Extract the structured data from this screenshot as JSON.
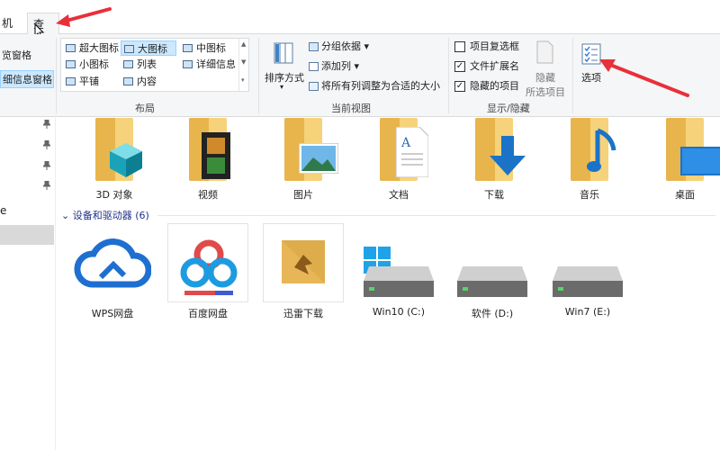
{
  "tabs": [
    {
      "label": "机"
    },
    {
      "label": "查看"
    }
  ],
  "panes": {
    "preview_pane": "览窗格",
    "details_pane": "细信息窗格"
  },
  "layout": {
    "group_label": "布局",
    "items": [
      {
        "label": "超大图标"
      },
      {
        "label": "大图标"
      },
      {
        "label": "中图标"
      },
      {
        "label": "小图标"
      },
      {
        "label": "列表"
      },
      {
        "label": "详细信息"
      },
      {
        "label": "平铺"
      },
      {
        "label": "内容"
      }
    ]
  },
  "current_view": {
    "group_label": "当前视图",
    "sort_by": "排序方式",
    "group_by": "分组依据",
    "add_column": "添加列",
    "fit_columns": "将所有列调整为合适的大小"
  },
  "show_hide": {
    "group_label": "显示/隐藏",
    "checkboxes": [
      {
        "label": "项目复选框",
        "checked": false
      },
      {
        "label": "文件扩展名",
        "checked": true
      },
      {
        "label": "隐藏的项目",
        "checked": true
      }
    ],
    "hide_selected_line1": "隐藏",
    "hide_selected_line2": "所选项目"
  },
  "options": {
    "label": "选项"
  },
  "navpane": {
    "cut_text": "e"
  },
  "folders": [
    {
      "label": "3D 对象",
      "icon": "3d-cube-icon"
    },
    {
      "label": "视频",
      "icon": "film-icon"
    },
    {
      "label": "图片",
      "icon": "picture-icon"
    },
    {
      "label": "文档",
      "icon": "document-icon"
    },
    {
      "label": "下载",
      "icon": "download-arrow-icon"
    },
    {
      "label": "音乐",
      "icon": "music-note-icon"
    },
    {
      "label": "桌面",
      "icon": "desktop-icon"
    }
  ],
  "devices": {
    "header": "设备和驱动器 (6)",
    "items": [
      {
        "label": "WPS网盘"
      },
      {
        "label": "百度网盘"
      },
      {
        "label": "迅雷下载"
      },
      {
        "label": "Win10 (C:)"
      },
      {
        "label": "软件 (D:)"
      },
      {
        "label": "Win7 (E:)"
      }
    ]
  },
  "colors": {
    "accent_blue": "#1e3287",
    "selection": "#cce8ff",
    "folder_yellow": "#f6d27a",
    "annotation_red": "#e8303a"
  }
}
